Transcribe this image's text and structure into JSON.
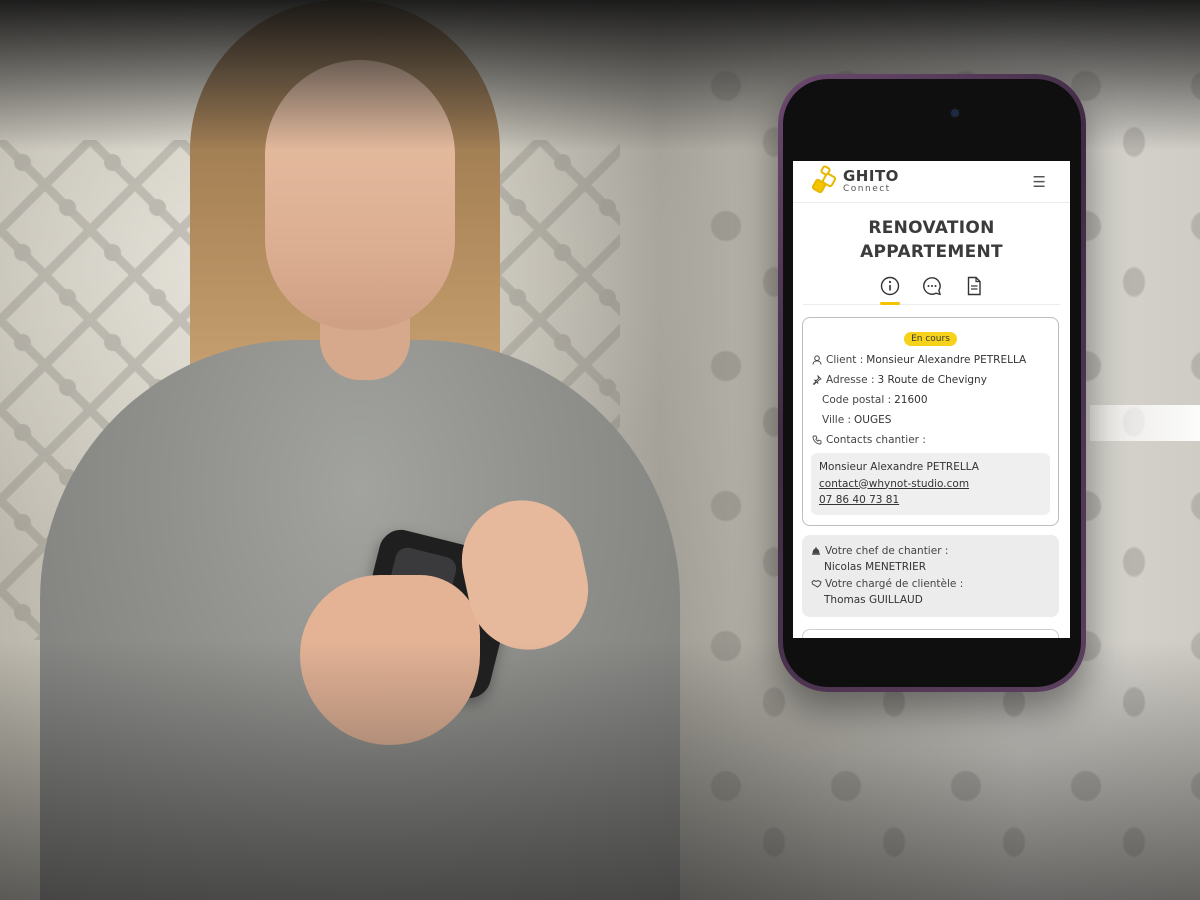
{
  "app": {
    "brand_name": "GHITO",
    "brand_sub": "Connect",
    "menu_icon": "hamburger-menu-icon"
  },
  "project": {
    "title_line1": "RENOVATION",
    "title_line2": "APPARTEMENT",
    "status": "En cours"
  },
  "tabs": [
    {
      "icon": "info-icon",
      "active": true
    },
    {
      "icon": "chat-icon",
      "active": false
    },
    {
      "icon": "document-icon",
      "active": false
    }
  ],
  "details": {
    "client_label": "Client :",
    "client_value": "Monsieur Alexandre PETRELLA",
    "address_label": "Adresse :",
    "address_value": "3 Route de Chevigny",
    "postal_label": "Code postal :",
    "postal_value": "21600",
    "city_label": "Ville :",
    "city_value": "OUGES",
    "contacts_label": "Contacts chantier :"
  },
  "contact": {
    "name": "Monsieur Alexandre PETRELLA",
    "email": "contact@whynot-studio.com",
    "phone": "07 86 40 73 81"
  },
  "team": {
    "foreman_label": "Votre chef de chantier :",
    "foreman_name": "Nicolas MENETRIER",
    "account_label": "Votre chargé de clientèle :",
    "account_name": "Thomas GUILLAUD"
  },
  "colors": {
    "accent": "#f4c400",
    "badge": "#f7d21a",
    "phone_frame": "#4a3350"
  }
}
